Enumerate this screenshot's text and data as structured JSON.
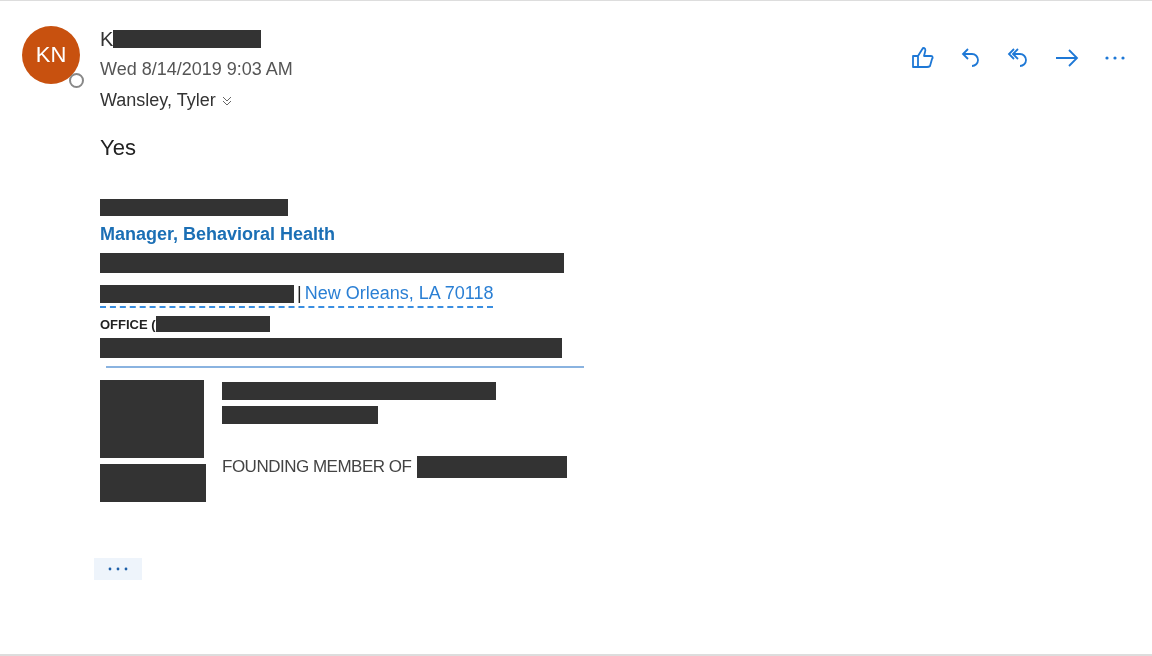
{
  "sender": {
    "initials": "KN",
    "name_visible": "K",
    "date": "Wed 8/14/2019 9:03 AM",
    "recipient": "Wansley, Tyler"
  },
  "body": "Yes",
  "signature": {
    "title": "Manager, Behavioral Health",
    "separator": "|",
    "address": "New Orleans, LA 70118",
    "office_label": "OFFICE (",
    "founding": "FOUNDING MEMBER OF"
  }
}
